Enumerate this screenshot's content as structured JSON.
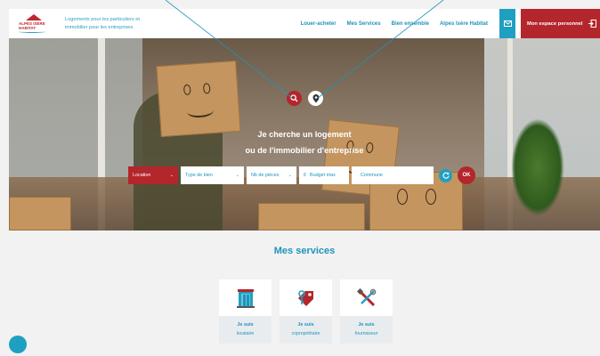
{
  "header": {
    "logo_line1": "ALPES ISÈRE",
    "logo_line2": "HABITAT",
    "tagline": "Logements pour les particuliers et immobilier pour les entreprises.",
    "nav": [
      {
        "label": "Louer-acheter"
      },
      {
        "label": "Mes Services"
      },
      {
        "label": "Bien ensemble"
      },
      {
        "label": "Alpes Isère Habitat"
      }
    ],
    "mail_icon": "envelope-icon",
    "account_label": "Mon espace personnel",
    "account_icon": "logout-icon",
    "colors": {
      "accent_red": "#b3262b",
      "accent_blue": "#1d94bb",
      "header_bg": "#ffffff"
    }
  },
  "hero": {
    "title_line1": "Je cherche un logement",
    "title_line2": "ou de l'immobilier d'entreprise",
    "icons": [
      "search-icon",
      "map-pin-icon"
    ],
    "search": {
      "transaction": "Location",
      "property_type": "Type de bien",
      "rooms": "Nb de pièces",
      "budget_prefix": "€",
      "budget": "Budget max",
      "commune": "Commune",
      "submit": "OK",
      "reset_icon": "refresh-icon"
    }
  },
  "services": {
    "title": "Mes services",
    "cards": [
      {
        "line1": "Je suis",
        "line2": "locataire",
        "icon": "door-icon"
      },
      {
        "line1": "Je suis",
        "line2": "copropriétaire",
        "icon": "key-tag-icon"
      },
      {
        "line1": "Je suis",
        "line2": "fournisseur",
        "icon": "tools-icon"
      }
    ]
  }
}
